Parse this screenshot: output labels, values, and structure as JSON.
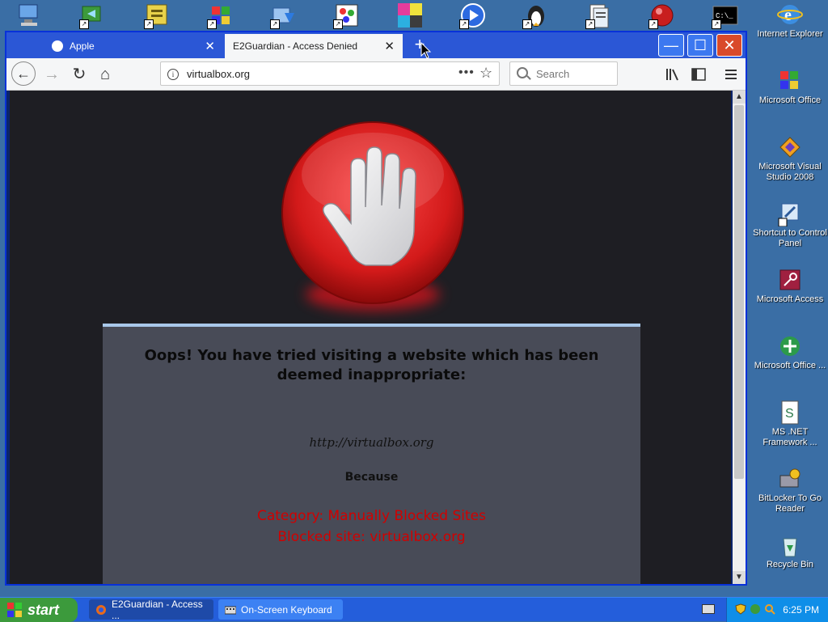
{
  "desktop": {
    "right_icons": [
      {
        "label": "Internet Explorer",
        "icon": "internet-explorer-icon"
      },
      {
        "label": "Microsoft Office",
        "icon": "microsoft-office-icon"
      },
      {
        "label": "Microsoft Visual Studio 2008",
        "icon": "visual-studio-icon"
      },
      {
        "label": "Shortcut to Control Panel",
        "icon": "control-panel-icon"
      },
      {
        "label": "Microsoft Access",
        "icon": "microsoft-access-icon"
      },
      {
        "label": "Microsoft Office ...",
        "icon": "microsoft-office-2-icon"
      },
      {
        "label": "MS .NET Framework ...",
        "icon": "dotnet-framework-icon"
      },
      {
        "label": "BitLocker To Go Reader",
        "icon": "bitlocker-icon"
      },
      {
        "label": "Recycle Bin",
        "icon": "recycle-bin-icon"
      }
    ],
    "top_icons": [
      "my-computer-icon",
      "network-sync-icon",
      "notepad-icon",
      "windows-update-icon",
      "download-icon",
      "paint-icon",
      "color-swatch-icon",
      "media-player-icon",
      "linux-penguin-icon",
      "document-folder-icon",
      "red-ball-icon",
      "command-prompt-icon"
    ]
  },
  "browser": {
    "tabs": [
      {
        "label": "Apple",
        "close": "✕"
      },
      {
        "label": "E2Guardian - Access Denied",
        "close": "✕"
      }
    ],
    "new_tab": "+",
    "window_buttons": {
      "minimize": "—",
      "maximize": "☐",
      "close": "✕"
    },
    "url": "virtualbox.org",
    "search_placeholder": "Search",
    "more": "•••"
  },
  "page": {
    "title": "Oops! You have tried visiting a website which has been deemed inappropriate:",
    "blocked_url": "http://virtualbox.org",
    "because": "Because",
    "category": "Category: Manually Blocked Sites",
    "blocked_site": "Blocked site: virtualbox.org"
  },
  "taskbar": {
    "start_label": "start",
    "tasks": [
      {
        "label": "E2Guardian - Access ...",
        "icon": "firefox-icon"
      },
      {
        "label": "On-Screen Keyboard",
        "icon": "keyboard-icon"
      }
    ],
    "clock": "6:25 PM"
  },
  "colors": {
    "desktop": "#3a6ea5",
    "page_bg": "#1e1e23",
    "message_box": "#484b57",
    "alert_red": "#d10000"
  }
}
